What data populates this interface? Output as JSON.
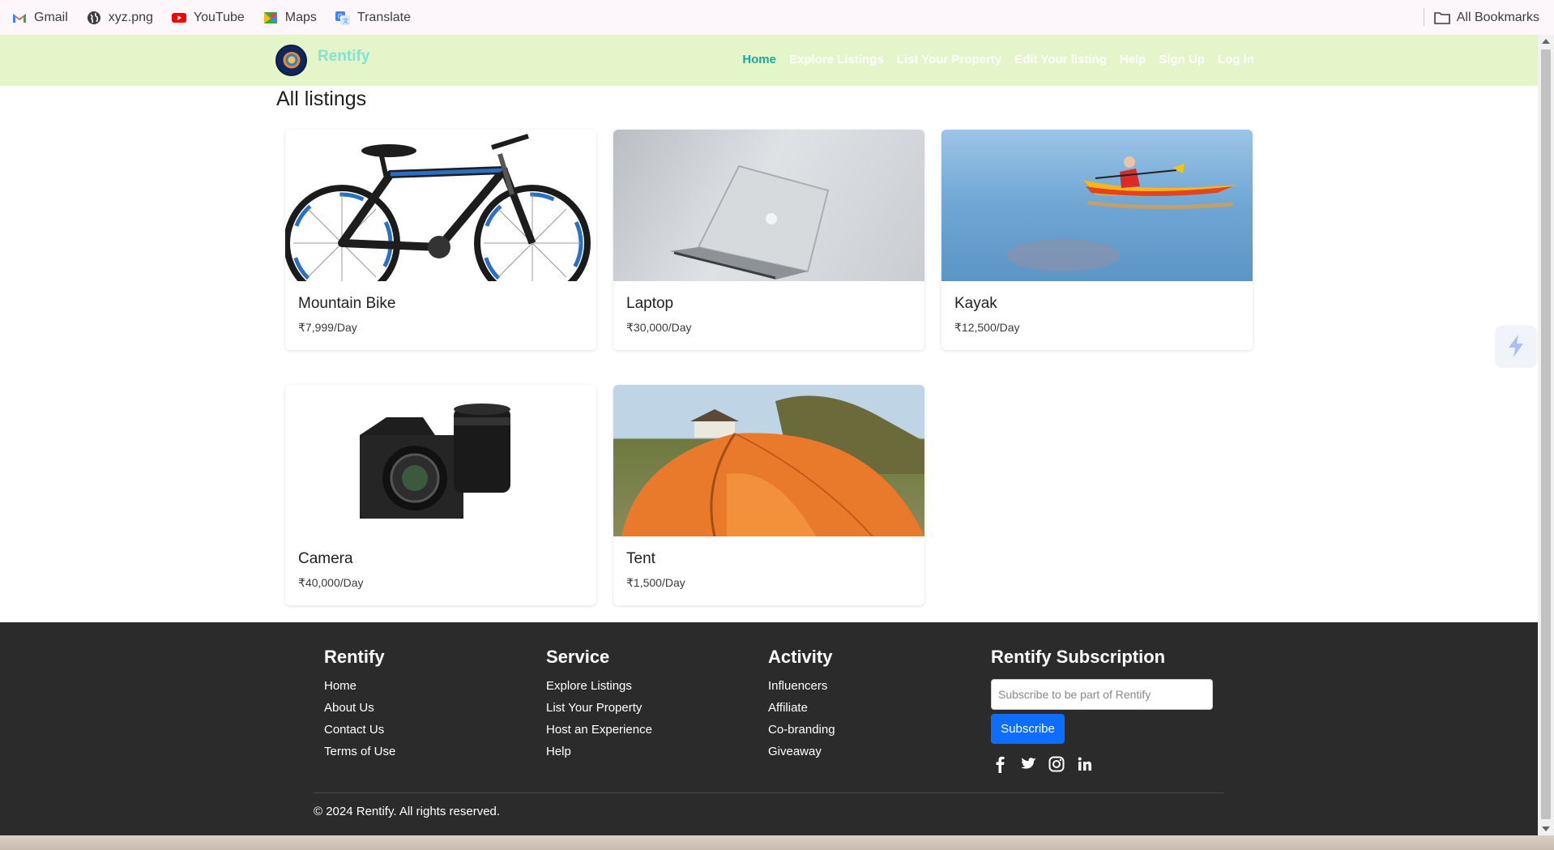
{
  "bookmarks": {
    "items": [
      {
        "label": "Gmail",
        "icon": "gmail-icon"
      },
      {
        "label": "xyz.png",
        "icon": "globe-icon"
      },
      {
        "label": "YouTube",
        "icon": "youtube-icon"
      },
      {
        "label": "Maps",
        "icon": "maps-icon"
      },
      {
        "label": "Translate",
        "icon": "translate-icon"
      }
    ],
    "all_bookmarks": "All Bookmarks"
  },
  "navbar": {
    "brand": "Rentify",
    "links": [
      "Home",
      "Explore Listings",
      "List Your Property",
      "Edit Your listing",
      "Help",
      "Sign Up",
      "Log In"
    ],
    "active": "Home",
    "colors": {
      "background": "#e3f5c9",
      "brand": "#7fe3d6",
      "active": "#1aa89a"
    }
  },
  "main": {
    "title": "All listings",
    "listings": [
      {
        "title": "Mountain Bike",
        "price": "₹7,999/Day",
        "image": "mountain-bike"
      },
      {
        "title": "Laptop",
        "price": "₹30,000/Day",
        "image": "laptop"
      },
      {
        "title": "Kayak",
        "price": "₹12,500/Day",
        "image": "kayak"
      },
      {
        "title": "Camera",
        "price": "₹40,000/Day",
        "image": "camera"
      },
      {
        "title": "Tent",
        "price": "₹1,500/Day",
        "image": "tent"
      }
    ]
  },
  "footer": {
    "col1": {
      "heading": "Rentify",
      "links": [
        "Home",
        "About Us",
        "Contact Us",
        "Terms of Use"
      ]
    },
    "col2": {
      "heading": "Service",
      "links": [
        "Explore Listings",
        "List Your Property",
        "Host an Experience",
        "Help"
      ]
    },
    "col3": {
      "heading": "Activity",
      "links": [
        "Influencers",
        "Affiliate",
        "Co-branding",
        "Giveaway"
      ]
    },
    "subscription": {
      "heading": "Rentify Subscription",
      "placeholder": "Subscribe to be part of Rentify",
      "button": "Subscribe",
      "socials": [
        "facebook-icon",
        "twitter-icon",
        "instagram-icon",
        "linkedin-icon"
      ]
    },
    "copyright": "© 2024 Rentify. All rights reserved.",
    "colors": {
      "background": "#2b2b2b",
      "button": "#0d6efd"
    }
  }
}
